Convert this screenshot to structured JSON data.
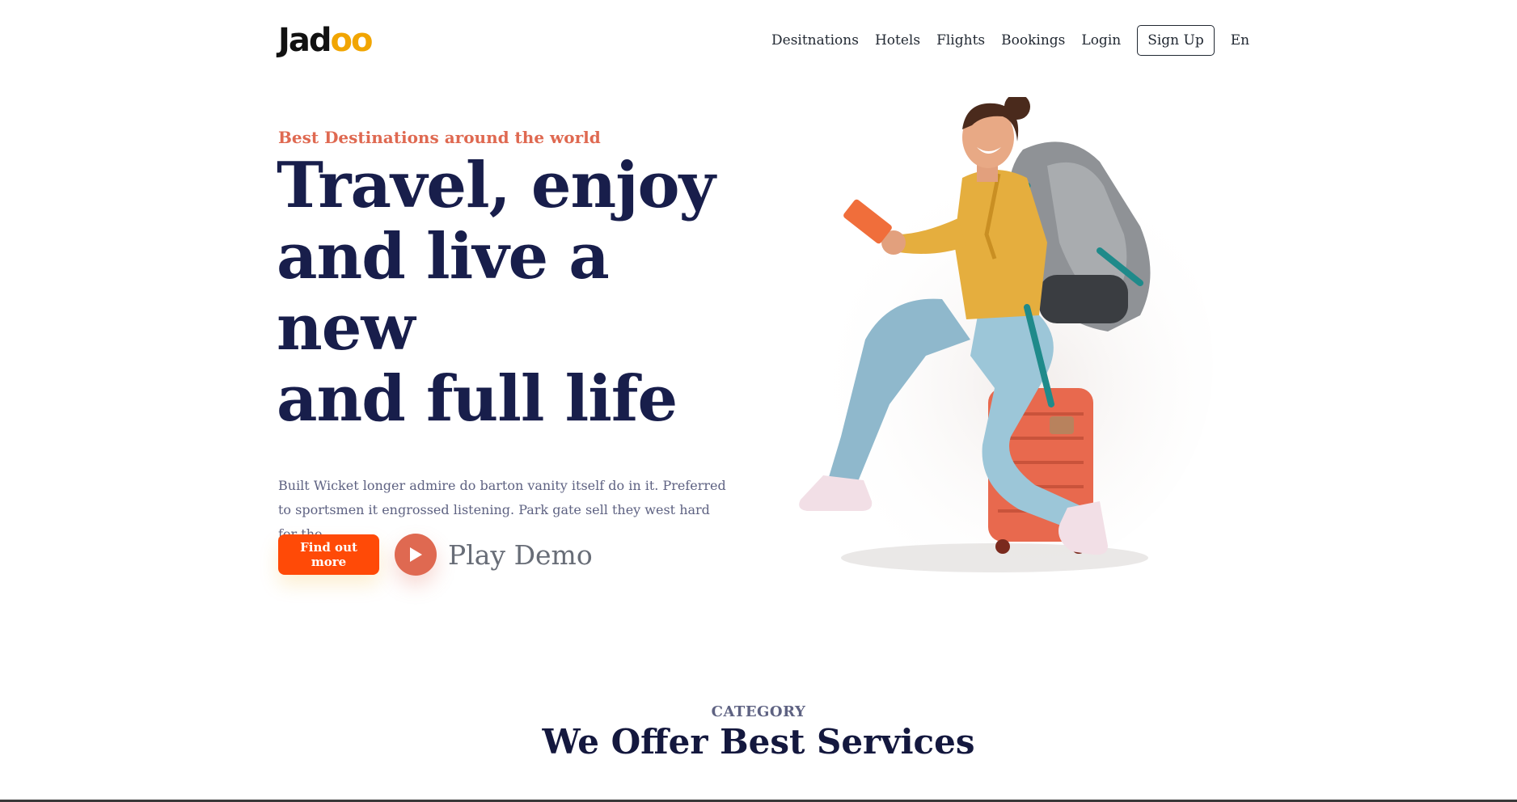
{
  "brand": {
    "logo_prefix": "Jad",
    "logo_suffix": "oo",
    "accent_color": "#F1A501"
  },
  "nav": {
    "items": [
      "Desitnations",
      "Hotels",
      "Flights",
      "Bookings",
      "Login"
    ],
    "signup_label": "Sign Up",
    "language": "En"
  },
  "hero": {
    "eyebrow": "Best Destinations around the world",
    "headline_lines": [
      "Travel, enjoy",
      "and live a",
      "new",
      "and full life"
    ],
    "description": "Built Wicket longer admire do barton vanity itself do in it. Preferred to sportsmen it engrossed listening. Park gate sell they west hard for the.",
    "cta_label": "Find out more",
    "play_label": "Play Demo",
    "colors": {
      "eyebrow": "#DF6951",
      "headline": "#181E4B",
      "cta": "#FF4A07",
      "play": "#DF6951"
    },
    "image_icon": "traveler-with-suitcase-illustration"
  },
  "category": {
    "label": "CATEGORY",
    "title": "We Offer Best Services"
  }
}
